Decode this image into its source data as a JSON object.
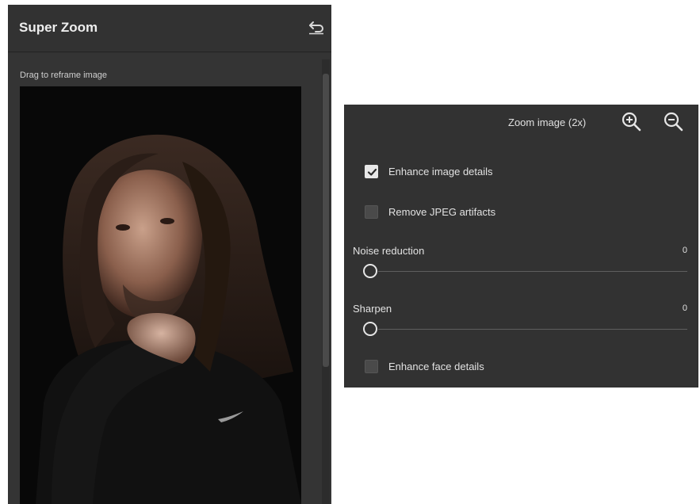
{
  "left_panel": {
    "title": "Super Zoom",
    "drag_label": "Drag to reframe image",
    "icons": {
      "reset": "undo-icon"
    }
  },
  "right_panel": {
    "zoom_label": "Zoom image (2x)",
    "icons": {
      "zoom_in": "zoom-in-icon",
      "zoom_out": "zoom-out-icon"
    },
    "checkboxes": [
      {
        "label": "Enhance image details",
        "checked": true
      },
      {
        "label": "Remove JPEG artifacts",
        "checked": false
      },
      {
        "label": "Enhance face details",
        "checked": false
      }
    ],
    "sliders": [
      {
        "label": "Noise reduction",
        "value": "0"
      },
      {
        "label": "Sharpen",
        "value": "0"
      }
    ]
  },
  "colors": {
    "panel_bg": "#323232",
    "text": "#e2e2e2",
    "image_bg": "#0a0a0a"
  }
}
